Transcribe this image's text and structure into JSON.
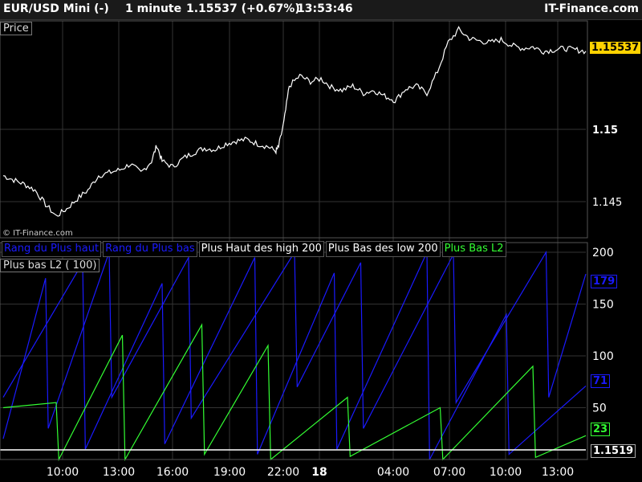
{
  "header": {
    "instrument": "EUR/USD Mini (-)",
    "interval": "1 minute",
    "last": "1.15537 (+0.67%)",
    "time": "13:53:46",
    "brand": "IT-Finance.com"
  },
  "price_panel": {
    "label": "Price",
    "copyright": "© IT-Finance.com",
    "last_tag": "1.15537"
  },
  "indicator_panel": {
    "legend": [
      {
        "label": "Rang du Plus haut",
        "color": "#1a1aff"
      },
      {
        "label": "Rang du Plus bas",
        "color": "#1a1aff"
      },
      {
        "label": "Plus Haut des high 200",
        "color": "#ffffff"
      },
      {
        "label": "Plus Bas des low 200",
        "color": "#ffffff"
      },
      {
        "label": "Plus Bas L2",
        "color": "#33ff33"
      }
    ],
    "sub_label": "Plus bas L2 ( 100)",
    "tags": {
      "blue_top": "179",
      "blue_low": "71",
      "green": "23",
      "white": "1.1519"
    }
  },
  "colors": {
    "price_line": "#ffffff",
    "rank_high": "#1a1aff",
    "rank_low": "#1a1aff",
    "plus_bas_l2": "#33ff33",
    "grid": "#333333",
    "tag_bg": "#ffd200"
  },
  "chart_data": [
    {
      "type": "line",
      "title": "Price",
      "ylim": [
        1.1425,
        1.1575
      ],
      "y_ticks": [
        "1.145",
        "1.15"
      ],
      "x": [
        0,
        4,
        8,
        12,
        16,
        20,
        24,
        28,
        32,
        36,
        40,
        44,
        48,
        52,
        56,
        58,
        60,
        64,
        68,
        72,
        76,
        80,
        84,
        88,
        92,
        96,
        100,
        103,
        104,
        106,
        108,
        112,
        116,
        120,
        124,
        128,
        132,
        136,
        140,
        144,
        148,
        152,
        156,
        160,
        164,
        168,
        172,
        176,
        180,
        184,
        188,
        192,
        196,
        200,
        204,
        208,
        212,
        216,
        220
      ],
      "values": [
        1.1468,
        1.1465,
        1.1462,
        1.1458,
        1.1448,
        1.144,
        1.1445,
        1.1452,
        1.1458,
        1.1468,
        1.147,
        1.1472,
        1.1476,
        1.147,
        1.1478,
        1.1489,
        1.1478,
        1.1474,
        1.148,
        1.1484,
        1.1487,
        1.1486,
        1.149,
        1.1492,
        1.1493,
        1.149,
        1.1488,
        1.1485,
        1.1488,
        1.1505,
        1.153,
        1.1537,
        1.1533,
        1.1535,
        1.1529,
        1.1527,
        1.153,
        1.1525,
        1.1527,
        1.1523,
        1.152,
        1.1528,
        1.153,
        1.1525,
        1.154,
        1.156,
        1.1569,
        1.1563,
        1.1561,
        1.156,
        1.1562,
        1.1558,
        1.1556,
        1.1557,
        1.1554,
        1.1555,
        1.1556,
        1.1555,
        1.1554
      ],
      "grid": true
    },
    {
      "type": "line",
      "ylim": [
        0,
        200
      ],
      "y_ticks": [
        "200",
        "150",
        "100",
        "50"
      ],
      "x_ticks": [
        "10:00",
        "13:00",
        "16:00",
        "19:00",
        "22:00",
        "18",
        "04:00",
        "07:00",
        "10:00",
        "13:00"
      ],
      "series": [
        {
          "name": "Rang du Plus haut",
          "x": [
            0,
            16,
            17,
            40,
            41,
            70,
            71,
            110,
            111,
            135,
            136,
            170,
            171,
            205,
            206,
            220
          ],
          "values": [
            20,
            175,
            30,
            200,
            60,
            195,
            40,
            200,
            70,
            190,
            30,
            198,
            55,
            200,
            60,
            179
          ]
        },
        {
          "name": "Rang du Plus bas",
          "x": [
            0,
            30,
            31,
            60,
            61,
            95,
            96,
            125,
            126,
            160,
            161,
            190,
            191,
            220
          ],
          "values": [
            60,
            190,
            10,
            170,
            15,
            195,
            5,
            180,
            10,
            200,
            0,
            140,
            5,
            71
          ]
        },
        {
          "name": "Plus Bas L2",
          "x": [
            0,
            20,
            21,
            45,
            46,
            75,
            76,
            100,
            101,
            130,
            131,
            165,
            166,
            200,
            201,
            220
          ],
          "values": [
            50,
            55,
            0,
            120,
            0,
            130,
            5,
            110,
            0,
            60,
            3,
            50,
            0,
            90,
            2,
            23
          ]
        }
      ],
      "grid": true
    }
  ]
}
